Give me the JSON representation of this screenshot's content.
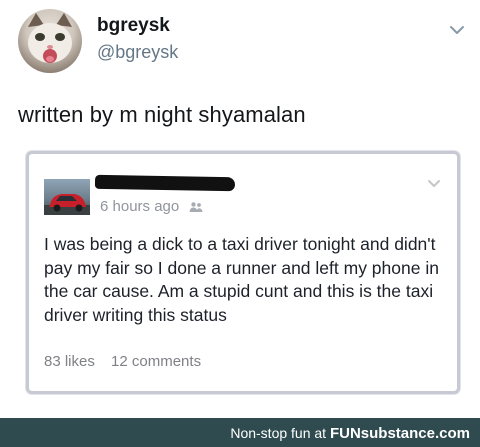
{
  "tweet": {
    "display_name": "bgreysk",
    "handle": "@bgreysk",
    "text": "written by m night shyamalan"
  },
  "post": {
    "time": "6 hours ago",
    "body": "I was being a dick to a taxi driver tonight and didn't pay my fair so I done a runner and left my phone in the car cause. Am a stupid cunt and this is the taxi driver writing this status",
    "likes": "83 likes",
    "comments": "12 comments"
  },
  "footer": {
    "prefix": "Non-stop fun at ",
    "brand": "FUNsubstance.com"
  },
  "icons": {
    "tweet_menu": "chevron-down-icon",
    "post_menu": "chevron-down-icon",
    "audience": "friends-icon"
  },
  "colors": {
    "footer_bg": "#2f4b4f",
    "card_border": "#c7c9d3",
    "handle": "#657786"
  }
}
